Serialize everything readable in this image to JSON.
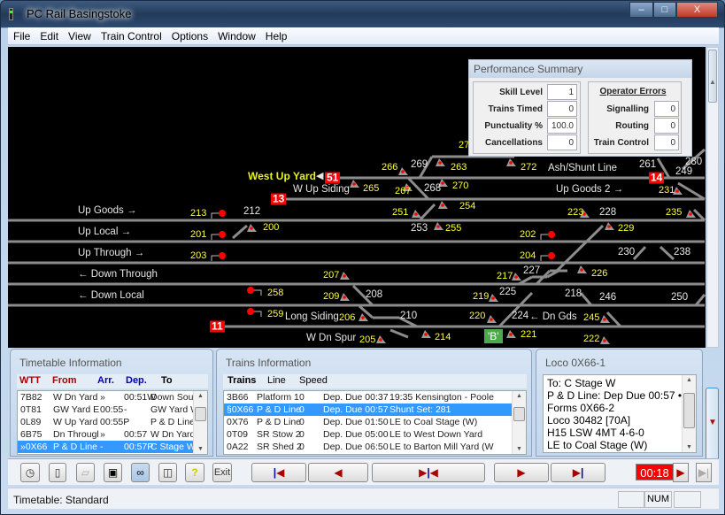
{
  "window": {
    "title": "PC Rail Basingstoke",
    "minimize": "–",
    "maximize": "□",
    "close": "X"
  },
  "menu": [
    "File",
    "Edit",
    "View",
    "Train Control",
    "Options",
    "Window",
    "Help"
  ],
  "diagram": {
    "labels": [
      "West Up Yard",
      "W Up Siding",
      "Up Goods →",
      "213",
      "212",
      "Up Local  →",
      "201",
      "200",
      "Up Through  →",
      "203",
      "← Down Through",
      "207",
      "← Down Local",
      "258",
      "209",
      "259",
      "Long Siding",
      "206",
      "W Dn Spur",
      "205",
      "274",
      "266",
      "269",
      "263",
      "272",
      "Ash/Shunt Line",
      "261",
      "280",
      "249",
      "265",
      "267",
      "268",
      "270",
      "Up Goods 2  →",
      "231",
      "251",
      "254",
      "223",
      "228",
      "235",
      "253",
      "255",
      "202",
      "229",
      "204",
      "230",
      "238",
      "217",
      "227",
      "226",
      "208",
      "219",
      "225",
      "218",
      "246",
      "250",
      "210",
      "220",
      "224",
      "← Dn Gds",
      "245",
      "214",
      "221",
      "222"
    ],
    "berths": [
      "51",
      "13",
      "11",
      "14"
    ],
    "platform_marker": "'B'",
    "colors": {
      "track": "#8c8c8c",
      "signal_on": "#ff0000",
      "label_yellow": "#ffff32",
      "berth": "#ff0000"
    }
  },
  "performance": {
    "title": "Performance Summary",
    "stats": [
      {
        "label": "Skill Level",
        "value": "1"
      },
      {
        "label": "Trains Timed",
        "value": "0"
      },
      {
        "label": "Punctuality %",
        "value": "100.0"
      },
      {
        "label": "Cancellations",
        "value": "0"
      }
    ],
    "errors_title": "Operator Errors",
    "errors": [
      {
        "label": "Signalling",
        "value": "0"
      },
      {
        "label": "Routing",
        "value": "0"
      },
      {
        "label": "Train Control",
        "value": "0"
      }
    ]
  },
  "timetable": {
    "title": "Timetable Information",
    "headers": [
      "WTT",
      "From",
      "Arr.",
      "Dep.",
      "To"
    ],
    "rows": [
      [
        "7B82",
        "W Dn Yard",
        "»",
        "00:51W",
        "Down South"
      ],
      [
        "0T81",
        "GW Yard E",
        "00:55",
        "-",
        "GW Yard W"
      ],
      [
        "0L89",
        "W Up Yard",
        "00:55P",
        "-",
        "P & D Line"
      ],
      [
        "6B75",
        "Dn Througl",
        "»",
        "00:57",
        "W Dn Yard"
      ],
      [
        "»0X66",
        "P & D Line",
        "-",
        "00:57P",
        "C Stage W"
      ]
    ],
    "selected": 4
  },
  "trains": {
    "title": "Trains Information",
    "headers": [
      "Trains",
      "Line",
      "Speed"
    ],
    "rows": [
      [
        "3B66",
        "Platform 1",
        "0",
        "Dep. Due 00:37",
        "19:35 Kensington - Poole"
      ],
      [
        "§0X66",
        "P & D Line",
        "0",
        "Dep. Due 00:57",
        "Shunt Set: 281"
      ],
      [
        "0X76",
        "P & D Line",
        "0",
        "Dep. Due 01:50",
        "LE to Coal Stage (W)"
      ],
      [
        "0T09",
        "SR Stow 2",
        "0",
        "Dep. Due 05:00",
        "LE to West Down Yard"
      ],
      [
        "0A22",
        "SR Shed 2",
        "0",
        "Dep. Due 06:50",
        "LE to Barton Mill Yard (W"
      ]
    ],
    "selected": 1
  },
  "loco": {
    "title": "Loco 0X66-1",
    "lines": [
      "To: C Stage W",
      "P & D Line: Dep Due 00:57 •",
      "Forms 0X66-2",
      "Loco 30482 [70A]",
      "H15 LSW 4MT 4-6-0",
      "LE to Coal Stage (W)"
    ]
  },
  "toolbar": {
    "exit": "Exit",
    "clock": "00:18"
  },
  "status": {
    "text": "Timetable: Standard",
    "num": "NUM"
  }
}
